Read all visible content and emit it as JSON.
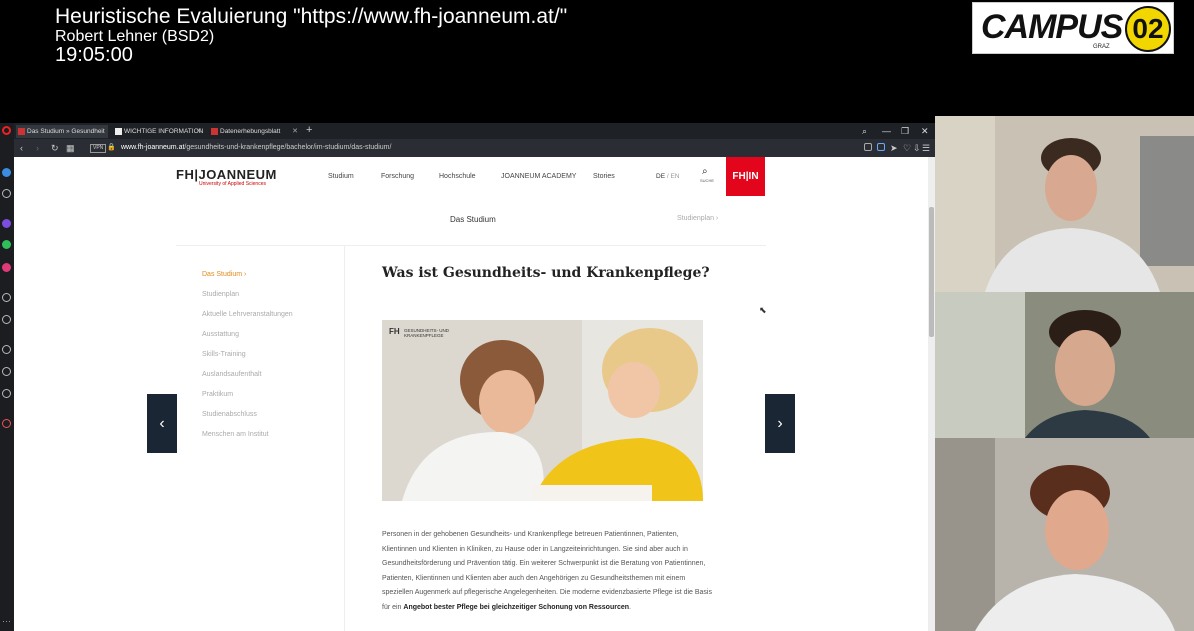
{
  "overlay": {
    "title": "Heuristische Evaluierung \"https://www.fh-joanneum.at/\"",
    "presenter": "Robert Lehner (BSD2)",
    "time": "19:05:00",
    "logo_text": "CAMPUS",
    "logo_number": "02",
    "logo_sub": "GRAZ"
  },
  "browser": {
    "tabs": [
      {
        "label": "Das Studium » Gesundheit",
        "active": true
      },
      {
        "label": "WICHTIGE INFORMATION",
        "active": false
      },
      {
        "label": "Datenerhebungsblatt",
        "active": false
      }
    ],
    "new_tab": "+",
    "vpn": "VPN",
    "url_domain": "www.fh-joanneum.at",
    "url_path": "/gesundheits-und-krankenpflege/bachelor/im-studium/das-studium/",
    "window_controls": [
      "⌕",
      "—",
      "❐",
      "✕"
    ]
  },
  "site": {
    "logo": "FH|JOANNEUM",
    "logo_sub": "University of Applied Sciences",
    "nav": [
      "Studium",
      "Forschung",
      "Hochschule",
      "JOANNEUM ACADEMY",
      "Stories"
    ],
    "lang_de": "DE",
    "lang_sep": " / ",
    "lang_en": "EN",
    "search_label": "SUCHE",
    "fhin_label": "FH|IN",
    "subnav_title": "Das Studium",
    "subnav_next": "Studienplan  ›",
    "side_items": [
      "Das Studium  ›",
      "Studienplan",
      "Aktuelle Lehrveranstaltungen",
      "Ausstattung",
      "Skills-Training",
      "Auslandsaufenthalt",
      "Praktikum",
      "Studienabschluss",
      "Menschen am Institut"
    ],
    "heading": "Was ist Gesundheits- und Krankenpflege?",
    "hero_logo": "FH",
    "hero_logo_sub": "GESUNDHEITS- UND KRANKENPFLEGE",
    "body_pre": "Personen in der gehobenen Gesundheits- und Krankenpflege betreuen Patientinnen, Patienten, Klientinnen und Klienten in Kliniken, zu Hause oder in Langzeiteinrichtungen. Sie sind aber auch in Gesundheitsförderung und Prävention tätig. Ein weiterer Schwerpunkt ist die Beratung von Patientinnen, Patienten, Klientinnen und Klienten aber auch den Angehörigen zu Gesundheitsthemen mit einem speziellen Augenmerk auf pflegerische Angelegenheiten. Die moderne evidenzbasierte Pflege ist die Basis für ein ",
    "body_bold": "Angebot bester Pflege bei gleichzeitiger Schonung von Ressourcen",
    "body_post": ".",
    "prev_arrow": "‹",
    "next_arrow": "›"
  }
}
